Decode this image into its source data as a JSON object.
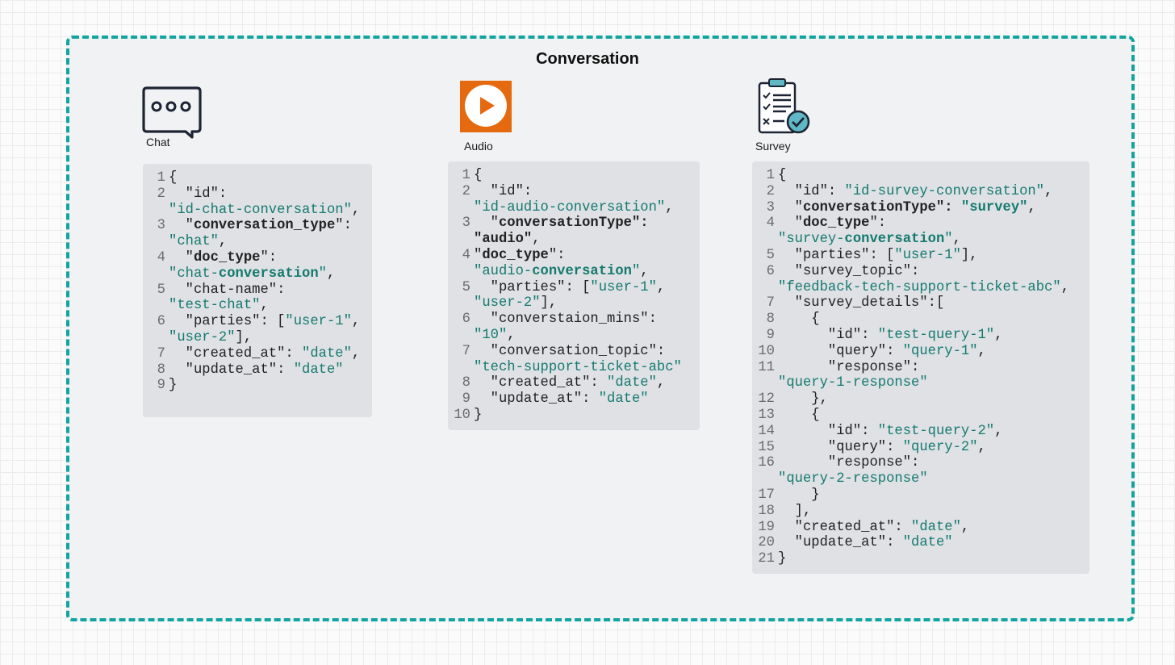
{
  "title": "Conversation",
  "colors": {
    "border": "#13a3a0",
    "string": "#157a6e",
    "audio_icon_bg": "#e56a0f",
    "panel_bg": "#dfe1e5"
  },
  "icons": {
    "chat": "speech-bubble-icon",
    "audio": "play-button-icon",
    "survey": "clipboard-checklist-icon"
  },
  "columns": [
    {
      "key": "chat",
      "label": "Chat",
      "lines": [
        {
          "n": "1",
          "tokens": [
            {
              "t": "{",
              "c": ""
            }
          ]
        },
        {
          "n": "2",
          "tokens": [
            {
              "t": "  \"id\":",
              "c": ""
            }
          ]
        },
        {
          "n": "",
          "tokens": [
            {
              "t": "\"id-chat-conversation\"",
              "c": "s"
            },
            {
              "t": ",",
              "c": ""
            }
          ]
        },
        {
          "n": "3",
          "tokens": [
            {
              "t": "  \"",
              "c": ""
            },
            {
              "t": "conversation_type",
              "c": "b"
            },
            {
              "t": "\":",
              "c": ""
            }
          ]
        },
        {
          "n": "",
          "tokens": [
            {
              "t": "\"chat\"",
              "c": "s"
            },
            {
              "t": ",",
              "c": ""
            }
          ]
        },
        {
          "n": "4",
          "tokens": [
            {
              "t": "  \"",
              "c": ""
            },
            {
              "t": "doc_type",
              "c": "b"
            },
            {
              "t": "\":",
              "c": ""
            }
          ]
        },
        {
          "n": "",
          "tokens": [
            {
              "t": "\"chat-",
              "c": "s"
            },
            {
              "t": "conversation",
              "c": "bs"
            },
            {
              "t": "\"",
              "c": "s"
            },
            {
              "t": ",",
              "c": ""
            }
          ]
        },
        {
          "n": "5",
          "tokens": [
            {
              "t": "  \"chat-name\":",
              "c": ""
            }
          ]
        },
        {
          "n": "",
          "tokens": [
            {
              "t": "\"test-chat\"",
              "c": "s"
            },
            {
              "t": ",",
              "c": ""
            }
          ]
        },
        {
          "n": "6",
          "tokens": [
            {
              "t": "  \"parties\": [",
              "c": ""
            },
            {
              "t": "\"user-1\"",
              "c": "s"
            },
            {
              "t": ",",
              "c": ""
            }
          ]
        },
        {
          "n": "",
          "tokens": [
            {
              "t": "\"user-2\"",
              "c": "s"
            },
            {
              "t": "],",
              "c": ""
            }
          ]
        },
        {
          "n": "7",
          "tokens": [
            {
              "t": "  \"created_at\": ",
              "c": ""
            },
            {
              "t": "\"date\"",
              "c": "s"
            },
            {
              "t": ",",
              "c": ""
            }
          ]
        },
        {
          "n": "8",
          "tokens": [
            {
              "t": "  \"update_at\": ",
              "c": ""
            },
            {
              "t": "\"date\"",
              "c": "s"
            }
          ]
        },
        {
          "n": "9",
          "tokens": [
            {
              "t": "}",
              "c": ""
            }
          ]
        }
      ]
    },
    {
      "key": "audio",
      "label": "Audio",
      "lines": [
        {
          "n": "1",
          "tokens": [
            {
              "t": "{",
              "c": ""
            }
          ]
        },
        {
          "n": "2",
          "tokens": [
            {
              "t": "  \"id\":",
              "c": ""
            }
          ]
        },
        {
          "n": "",
          "tokens": [
            {
              "t": "\"id-audio-conversation\"",
              "c": "s"
            },
            {
              "t": ",",
              "c": ""
            }
          ]
        },
        {
          "n": "3",
          "tokens": [
            {
              "t": "  \"",
              "c": ""
            },
            {
              "t": "conversationType\":",
              "c": "b"
            }
          ]
        },
        {
          "n": "",
          "tokens": [
            {
              "t": "\"audio\"",
              "c": "b"
            },
            {
              "t": ",",
              "c": ""
            }
          ]
        },
        {
          "n": "4",
          "tokens": [
            {
              "t": "\"",
              "c": ""
            },
            {
              "t": "doc_type",
              "c": "b"
            },
            {
              "t": "\":",
              "c": ""
            }
          ]
        },
        {
          "n": "",
          "tokens": [
            {
              "t": "\"audio-",
              "c": "s"
            },
            {
              "t": "conversation",
              "c": "bs"
            },
            {
              "t": "\"",
              "c": "s"
            },
            {
              "t": ",",
              "c": ""
            }
          ]
        },
        {
          "n": "5",
          "tokens": [
            {
              "t": "  \"parties\": [",
              "c": ""
            },
            {
              "t": "\"user-1\"",
              "c": "s"
            },
            {
              "t": ",",
              "c": ""
            }
          ]
        },
        {
          "n": "",
          "tokens": [
            {
              "t": "\"user-2\"",
              "c": "s"
            },
            {
              "t": "],",
              "c": ""
            }
          ]
        },
        {
          "n": "6",
          "tokens": [
            {
              "t": "  \"converstaion_mins\":",
              "c": ""
            }
          ]
        },
        {
          "n": "",
          "tokens": [
            {
              "t": "\"10\"",
              "c": "s"
            },
            {
              "t": ",",
              "c": ""
            }
          ]
        },
        {
          "n": "7",
          "tokens": [
            {
              "t": "  \"conversation_topic\":",
              "c": ""
            }
          ]
        },
        {
          "n": "",
          "tokens": [
            {
              "t": "\"tech-support-ticket-abc\"",
              "c": "s"
            }
          ]
        },
        {
          "n": "8",
          "tokens": [
            {
              "t": "  \"created_at\": ",
              "c": ""
            },
            {
              "t": "\"date\"",
              "c": "s"
            },
            {
              "t": ",",
              "c": ""
            }
          ]
        },
        {
          "n": "9",
          "tokens": [
            {
              "t": "  \"update_at\": ",
              "c": ""
            },
            {
              "t": "\"date\"",
              "c": "s"
            }
          ]
        },
        {
          "n": "10",
          "tokens": [
            {
              "t": "}",
              "c": ""
            }
          ]
        }
      ]
    },
    {
      "key": "survey",
      "label": "Survey",
      "lines": [
        {
          "n": "1",
          "tokens": [
            {
              "t": "{",
              "c": ""
            }
          ]
        },
        {
          "n": "2",
          "tokens": [
            {
              "t": "  \"id\": ",
              "c": ""
            },
            {
              "t": "\"id-survey-conversation\"",
              "c": "s"
            },
            {
              "t": ",",
              "c": ""
            }
          ]
        },
        {
          "n": "3",
          "tokens": [
            {
              "t": "  \"",
              "c": ""
            },
            {
              "t": "conversationType\": ",
              "c": "b"
            },
            {
              "t": "\"survey\"",
              "c": "bs"
            },
            {
              "t": ",",
              "c": ""
            }
          ]
        },
        {
          "n": "4",
          "tokens": [
            {
              "t": "  \"",
              "c": ""
            },
            {
              "t": "doc_type",
              "c": "b"
            },
            {
              "t": "\":",
              "c": ""
            }
          ]
        },
        {
          "n": "",
          "tokens": [
            {
              "t": "\"survey-",
              "c": "s"
            },
            {
              "t": "conversation",
              "c": "bs"
            },
            {
              "t": "\"",
              "c": "s"
            },
            {
              "t": ",",
              "c": ""
            }
          ]
        },
        {
          "n": "5",
          "tokens": [
            {
              "t": "  \"parties\": [",
              "c": ""
            },
            {
              "t": "\"user-1\"",
              "c": "s"
            },
            {
              "t": "],",
              "c": ""
            }
          ]
        },
        {
          "n": "6",
          "tokens": [
            {
              "t": "  \"survey_topic\":",
              "c": ""
            }
          ]
        },
        {
          "n": "",
          "tokens": [
            {
              "t": "\"feedback-tech-support-ticket-abc\"",
              "c": "s"
            },
            {
              "t": ",",
              "c": ""
            }
          ]
        },
        {
          "n": "7",
          "tokens": [
            {
              "t": "  \"survey_details\":[",
              "c": ""
            }
          ]
        },
        {
          "n": "8",
          "tokens": [
            {
              "t": "    {",
              "c": ""
            }
          ]
        },
        {
          "n": "9",
          "tokens": [
            {
              "t": "      \"id\": ",
              "c": ""
            },
            {
              "t": "\"test-query-1\"",
              "c": "s"
            },
            {
              "t": ",",
              "c": ""
            }
          ]
        },
        {
          "n": "10",
          "tokens": [
            {
              "t": "      \"query\": ",
              "c": ""
            },
            {
              "t": "\"query-1\"",
              "c": "s"
            },
            {
              "t": ",",
              "c": ""
            }
          ]
        },
        {
          "n": "11",
          "tokens": [
            {
              "t": "      \"response\":",
              "c": ""
            }
          ]
        },
        {
          "n": "",
          "tokens": [
            {
              "t": "\"query-1-response\"",
              "c": "s"
            }
          ]
        },
        {
          "n": "12",
          "tokens": [
            {
              "t": "    },",
              "c": ""
            }
          ]
        },
        {
          "n": "13",
          "tokens": [
            {
              "t": "    {",
              "c": ""
            }
          ]
        },
        {
          "n": "14",
          "tokens": [
            {
              "t": "      \"id\": ",
              "c": ""
            },
            {
              "t": "\"test-query-2\"",
              "c": "s"
            },
            {
              "t": ",",
              "c": ""
            }
          ]
        },
        {
          "n": "15",
          "tokens": [
            {
              "t": "      \"query\": ",
              "c": ""
            },
            {
              "t": "\"query-2\"",
              "c": "s"
            },
            {
              "t": ",",
              "c": ""
            }
          ]
        },
        {
          "n": "16",
          "tokens": [
            {
              "t": "      \"response\":",
              "c": ""
            }
          ]
        },
        {
          "n": "",
          "tokens": [
            {
              "t": "\"query-2-response\"",
              "c": "s"
            }
          ]
        },
        {
          "n": "17",
          "tokens": [
            {
              "t": "    }",
              "c": ""
            }
          ]
        },
        {
          "n": "18",
          "tokens": [
            {
              "t": "  ],",
              "c": ""
            }
          ]
        },
        {
          "n": "19",
          "tokens": [
            {
              "t": "  \"created_at\": ",
              "c": ""
            },
            {
              "t": "\"date\"",
              "c": "s"
            },
            {
              "t": ",",
              "c": ""
            }
          ]
        },
        {
          "n": "20",
          "tokens": [
            {
              "t": "  \"update_at\": ",
              "c": ""
            },
            {
              "t": "\"date\"",
              "c": "s"
            }
          ]
        },
        {
          "n": "21",
          "tokens": [
            {
              "t": "}",
              "c": ""
            }
          ]
        }
      ]
    }
  ]
}
